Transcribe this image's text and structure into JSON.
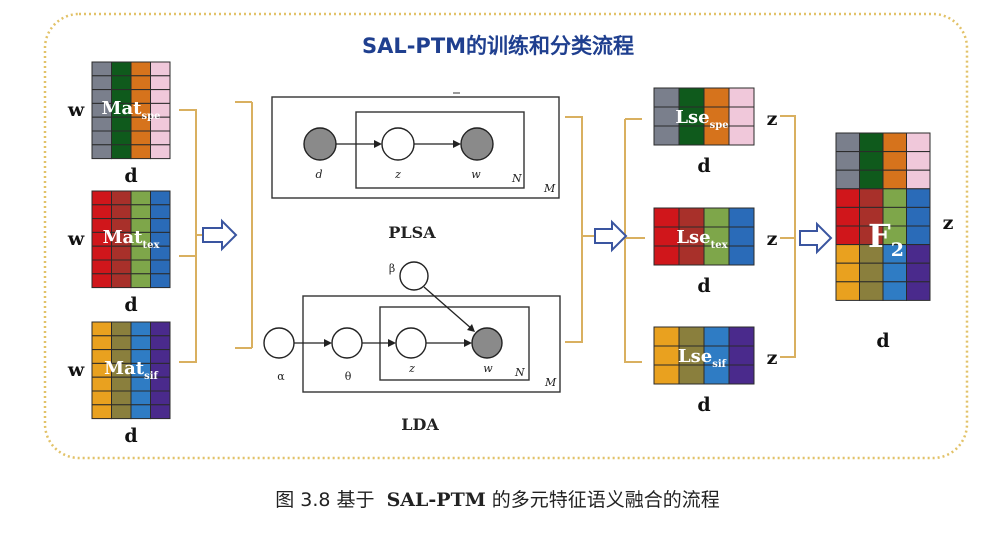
{
  "title": "SAL-PTM的训练和分类流程",
  "caption": {
    "prefix": "图 3.8 基于",
    "method": "SAL-PTM",
    "suffix": "的多元特征语义融合的流程"
  },
  "matrices": [
    {
      "base": "Mat",
      "sub": "spe",
      "row_label": "w",
      "col_label": "d"
    },
    {
      "base": "Mat",
      "sub": "tex",
      "row_label": "w",
      "col_label": "d"
    },
    {
      "base": "Mat",
      "sub": "sif",
      "row_label": "w",
      "col_label": "d"
    }
  ],
  "latent": [
    {
      "base": "Lse",
      "sub": "spe",
      "row_label": "z",
      "col_label": "d"
    },
    {
      "base": "Lse",
      "sub": "tex",
      "row_label": "z",
      "col_label": "d"
    },
    {
      "base": "Lse",
      "sub": "sif",
      "row_label": "z",
      "col_label": "d"
    }
  ],
  "fused": {
    "base": "F",
    "sub": "2",
    "row_label": "z",
    "col_label": "d"
  },
  "plsa": {
    "name": "PLSA",
    "nodes": [
      {
        "label": "d"
      },
      {
        "label": "z"
      },
      {
        "label": "w"
      }
    ],
    "plate_inner": "N",
    "plate_outer": "M"
  },
  "lda": {
    "name": "LDA",
    "nodes": [
      {
        "label": "α"
      },
      {
        "label": "θ"
      },
      {
        "label": "z"
      },
      {
        "label": "w"
      },
      {
        "label": "β"
      }
    ],
    "plate_inner": "N",
    "plate_outer": "M"
  },
  "colors": {
    "spe": [
      "#7a7f8c",
      "#0f5a1c",
      "#d6731c",
      "#f0c8da"
    ],
    "tex": [
      "#d0161b",
      "#a8302a",
      "#7ea64a",
      "#2a6bb8"
    ],
    "sif": [
      "#e9a11f",
      "#8a7f3d",
      "#2f7cc4",
      "#4a2a8c"
    ],
    "border": "#2b2b2b",
    "node_fill": "#8a8a8a",
    "outer_frame": "#e2c268",
    "arrow": "#3a55a0",
    "title": "#1f3f8f"
  }
}
